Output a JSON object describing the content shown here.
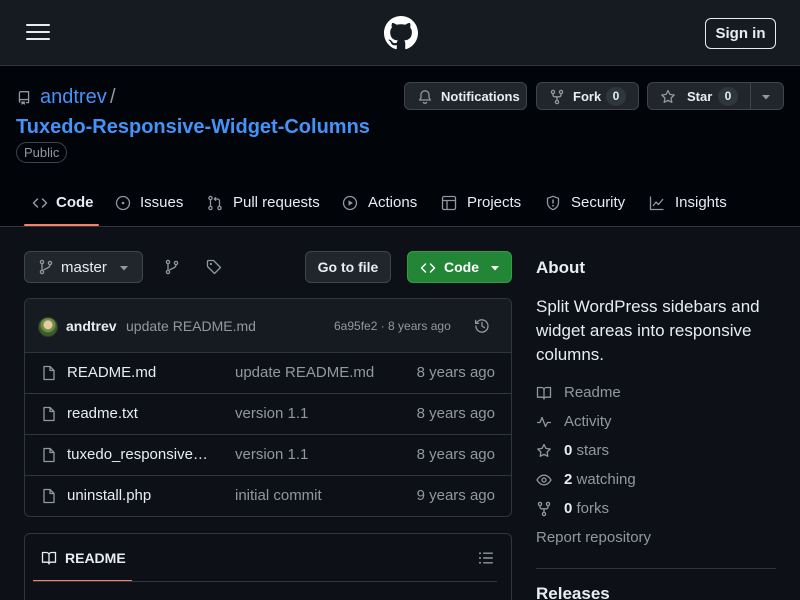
{
  "header": {
    "signin_label": "Sign in"
  },
  "repo": {
    "owner": "andtrev",
    "separator": "/",
    "name": "Tuxedo-Responsive-Widget-Columns",
    "visibility": "Public"
  },
  "actions": {
    "notifications_label": "Notifications",
    "fork_label": "Fork",
    "fork_count": "0",
    "star_label": "Star",
    "star_count": "0"
  },
  "tabs": [
    {
      "label": "Code",
      "icon": "code-icon",
      "selected": true
    },
    {
      "label": "Issues",
      "icon": "issue-opened-icon"
    },
    {
      "label": "Pull requests",
      "icon": "git-pull-request-icon"
    },
    {
      "label": "Actions",
      "icon": "play-icon"
    },
    {
      "label": "Projects",
      "icon": "table-icon"
    },
    {
      "label": "Security",
      "icon": "shield-icon"
    },
    {
      "label": "Insights",
      "icon": "graph-icon"
    }
  ],
  "toolbar": {
    "branch": "master",
    "goto_label": "Go to file",
    "code_label": "Code"
  },
  "commit": {
    "author": "andtrev",
    "message": "update README.md",
    "meta": "6a95fe2 · 8 years ago"
  },
  "files": [
    {
      "name": "README.md",
      "message": "update README.md",
      "date": "8 years ago"
    },
    {
      "name": "readme.txt",
      "message": "version 1.1",
      "date": "8 years ago"
    },
    {
      "name": "tuxedo_responsive…",
      "message": "version 1.1",
      "date": "8 years ago"
    },
    {
      "name": "uninstall.php",
      "message": "initial commit",
      "date": "9 years ago"
    }
  ],
  "readme": {
    "title": "README"
  },
  "about": {
    "title": "About",
    "description": "Split WordPress sidebars and widget areas into responsive columns.",
    "readme_label": "Readme",
    "activity_label": "Activity",
    "stars_count": "0",
    "stars_label": "stars",
    "watching_count": "2",
    "watching_label": "watching",
    "forks_count": "0",
    "forks_label": "forks",
    "report_label": "Report repository"
  },
  "releases": {
    "title": "Releases"
  },
  "colors": {
    "background": "#0d1117",
    "header": "#161b22",
    "link": "#4493f8",
    "primary_button": "#238636",
    "tab_underline": "#f78166"
  }
}
